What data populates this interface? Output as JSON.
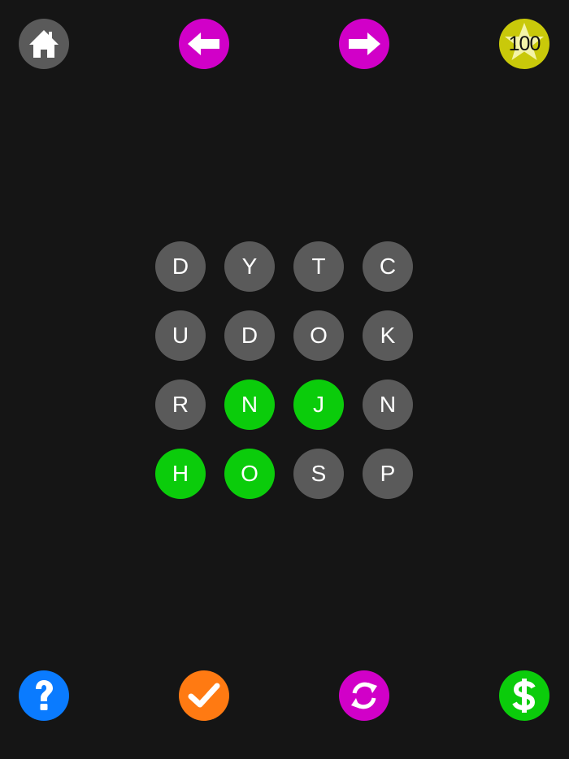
{
  "colors": {
    "background": "#151515",
    "tile_default": "#5a5a5a",
    "tile_selected": "#0bcc0b",
    "nav_arrow": "#d100c8",
    "home": "#5a5a5a",
    "score": "#c9c90a",
    "help": "#0a7bff",
    "check": "#ff7a12",
    "shuffle": "#d100c8",
    "store": "#0bcc0b"
  },
  "top_bar": {
    "home_icon": "home-icon",
    "prev_icon": "arrow-left-icon",
    "next_icon": "arrow-right-icon",
    "score_icon": "star-icon",
    "score_value": "100"
  },
  "grid": {
    "tiles": [
      {
        "letter": "D",
        "selected": false
      },
      {
        "letter": "Y",
        "selected": false
      },
      {
        "letter": "T",
        "selected": false
      },
      {
        "letter": "C",
        "selected": false
      },
      {
        "letter": "U",
        "selected": false
      },
      {
        "letter": "D",
        "selected": false
      },
      {
        "letter": "O",
        "selected": false
      },
      {
        "letter": "K",
        "selected": false
      },
      {
        "letter": "R",
        "selected": false
      },
      {
        "letter": "N",
        "selected": true
      },
      {
        "letter": "J",
        "selected": true
      },
      {
        "letter": "N",
        "selected": false
      },
      {
        "letter": "H",
        "selected": true
      },
      {
        "letter": "O",
        "selected": true
      },
      {
        "letter": "S",
        "selected": false
      },
      {
        "letter": "P",
        "selected": false
      }
    ]
  },
  "bottom_bar": {
    "help_icon": "question-mark-icon",
    "check_icon": "checkmark-icon",
    "shuffle_icon": "refresh-icon",
    "store_icon": "dollar-icon"
  }
}
